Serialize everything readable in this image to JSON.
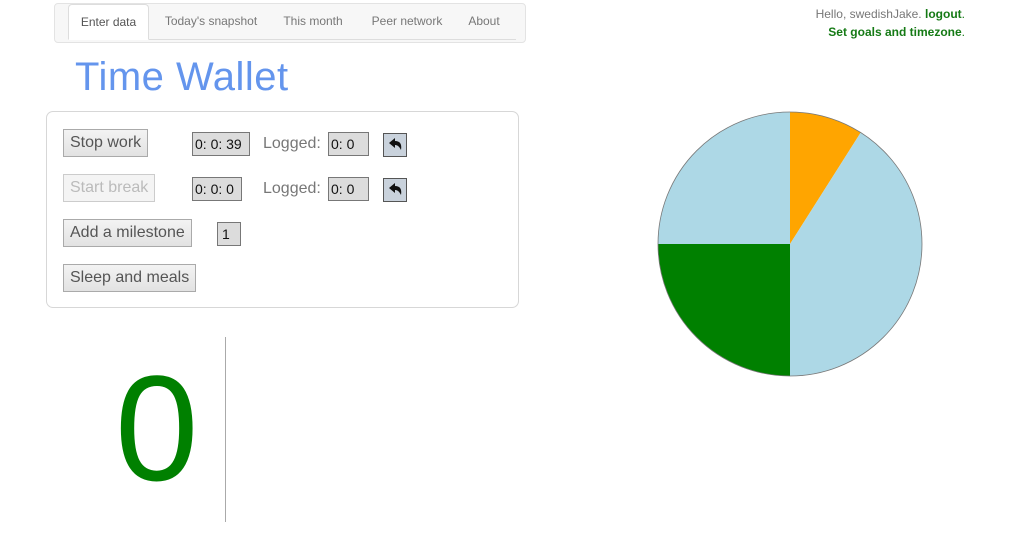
{
  "nav": {
    "tabs": [
      {
        "label": "Enter data",
        "active": true
      },
      {
        "label": "Today's snapshot",
        "active": false
      },
      {
        "label": "This month",
        "active": false
      },
      {
        "label": "Peer network",
        "active": false
      },
      {
        "label": "About",
        "active": false
      }
    ]
  },
  "header": {
    "greeting": "Hello, swedishJake.",
    "logout": "logout",
    "goals_link": "Set goals and timezone",
    "dot": "."
  },
  "title": "Time Wallet",
  "panel": {
    "work": {
      "button": "Stop work",
      "timer": "0: 0: 39",
      "logged_label": "Logged:",
      "logged_value": "0: 0"
    },
    "break": {
      "button": "Start break",
      "timer": "0: 0: 0",
      "logged_label": "Logged:",
      "logged_value": "0: 0"
    },
    "milestone": {
      "button": "Add a milestone",
      "count": "1"
    },
    "sleep": {
      "button": "Sleep and meals"
    }
  },
  "big_counter": "0",
  "chart_data": {
    "type": "pie",
    "slices": [
      {
        "value": 9,
        "color": "#ffa500"
      },
      {
        "value": 41,
        "color": "#add8e6"
      },
      {
        "value": 25,
        "color": "#008000"
      },
      {
        "value": 25,
        "color": "#add8e6"
      }
    ]
  }
}
